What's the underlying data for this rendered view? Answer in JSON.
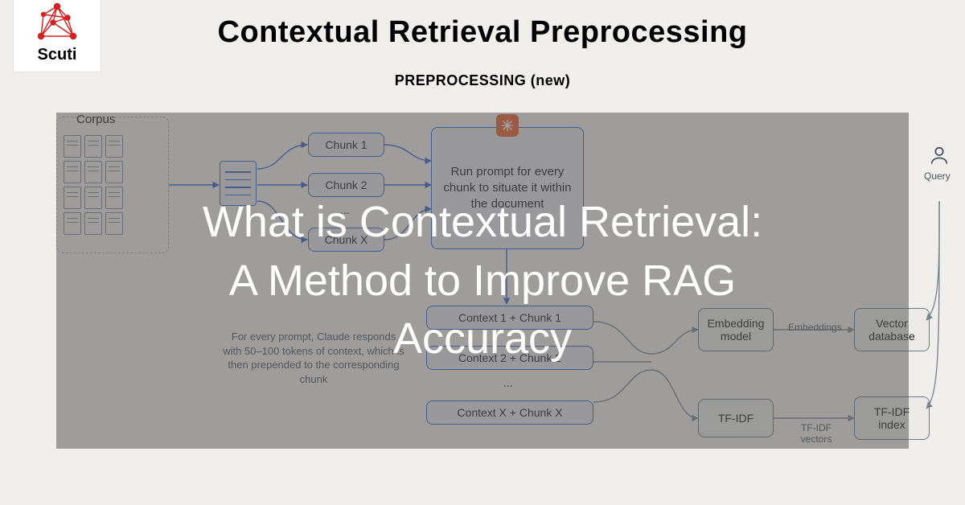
{
  "logo": {
    "text": "Scuti"
  },
  "page_title": "Contextual Retrieval Preprocessing",
  "section_title": "PREPROCESSING (new)",
  "corpus": {
    "label": "Corpus"
  },
  "chunks": {
    "c1": "Chunk 1",
    "c2": "Chunk 2",
    "dots": "...",
    "cx": "Chunk X"
  },
  "prompt_box": "Run prompt for every chunk to situate it within the document",
  "contexts": {
    "c1": "Context 1 + Chunk 1",
    "c2": "Context 2 + Chunk 2",
    "dots": "...",
    "cx": "Context X + Chunk X"
  },
  "caption": "For every prompt, Claude responds with 50–100 tokens of context, which is then prepended to the corresponding chunk",
  "right": {
    "embedding": "Embedding model",
    "tfidf": "TF-IDF",
    "vectordb": "Vector database",
    "tfidf_index": "TF-IDF index",
    "embeddings_label": "Embeddings",
    "tfidf_vectors_label": "TF-IDF vectors",
    "query": "Query"
  },
  "overlay": {
    "line1": "What is Contextual Retrieval:",
    "line2": "A Method to Improve RAG",
    "line3": "Accuracy"
  }
}
